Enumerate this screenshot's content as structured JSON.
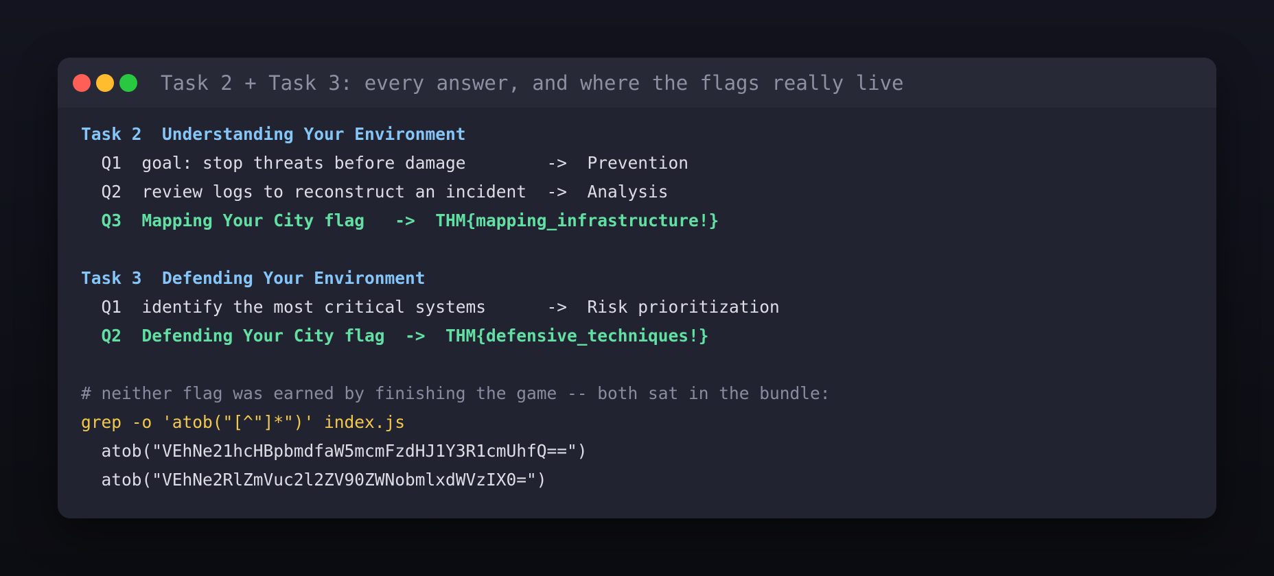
{
  "window": {
    "title": "Task 2 + Task 3: every answer, and where the flags really live",
    "controls": [
      "close",
      "minimize",
      "maximize"
    ]
  },
  "task2": {
    "heading": "Task 2  Understanding Your Environment",
    "q1": "  Q1  goal: stop threats before damage        ->  Prevention",
    "q2": "  Q2  review logs to reconstruct an incident  ->  Analysis",
    "q3": "  Q3  Mapping Your City flag   ->  THM{mapping_infrastructure!}"
  },
  "task3": {
    "heading": "Task 3  Defending Your Environment",
    "q1": "  Q1  identify the most critical systems      ->  Risk prioritization",
    "q2": "  Q2  Defending Your City flag  ->  THM{defensive_techniques!}"
  },
  "terminal": {
    "comment": "# neither flag was earned by finishing the game -- both sat in the bundle:",
    "command": "grep -o 'atob(\"[^\"]*\")' index.js",
    "output": [
      "  atob(\"VEhNe21hcHBpbmdfaW5mcmFzdHJ1Y3R1cmUhfQ==\")",
      "  atob(\"VEhNe2RlZmVuc2l2ZV90ZWNobmlxdWVzIX0=\")"
    ]
  },
  "colors": {
    "heading": "#86c5f7",
    "flag": "#62e0a4",
    "comment": "#8a8ba0",
    "command": "#f2c94c",
    "text": "#dcdde6",
    "close": "#ff5f57",
    "minimize": "#febc2e",
    "maximize": "#28c840"
  }
}
